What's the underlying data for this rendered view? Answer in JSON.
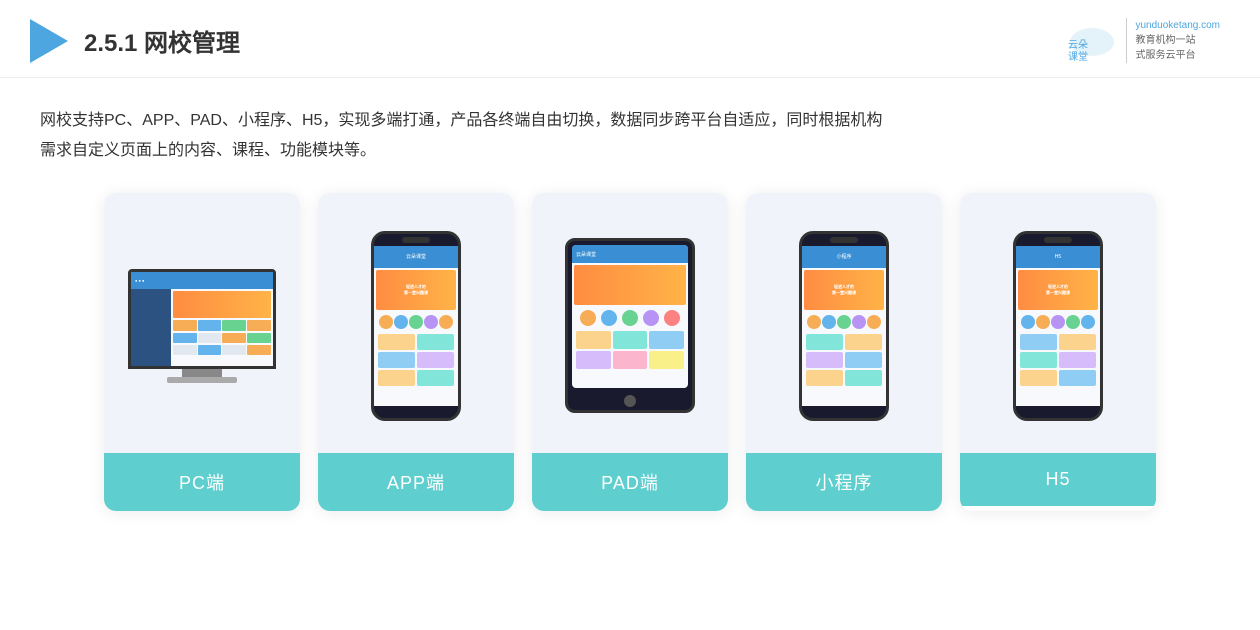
{
  "header": {
    "title_prefix": "2.5.1 ",
    "title_bold": "网校管理",
    "logo_site": "yunduoketang.com",
    "logo_slogan_line1": "教育机构一站",
    "logo_slogan_line2": "式服务云平台"
  },
  "description": {
    "line1": "网校支持PC、APP、PAD、小程序、H5，实现多端打通，产品各终端自由切换，数据同步跨平台自适应，同时根据机构",
    "line2": "需求自定义页面上的内容、课程、功能模块等。"
  },
  "cards": [
    {
      "id": "pc",
      "label": "PC端"
    },
    {
      "id": "app",
      "label": "APP端"
    },
    {
      "id": "pad",
      "label": "PAD端"
    },
    {
      "id": "miniprogram",
      "label": "小程序"
    },
    {
      "id": "h5",
      "label": "H5"
    }
  ]
}
